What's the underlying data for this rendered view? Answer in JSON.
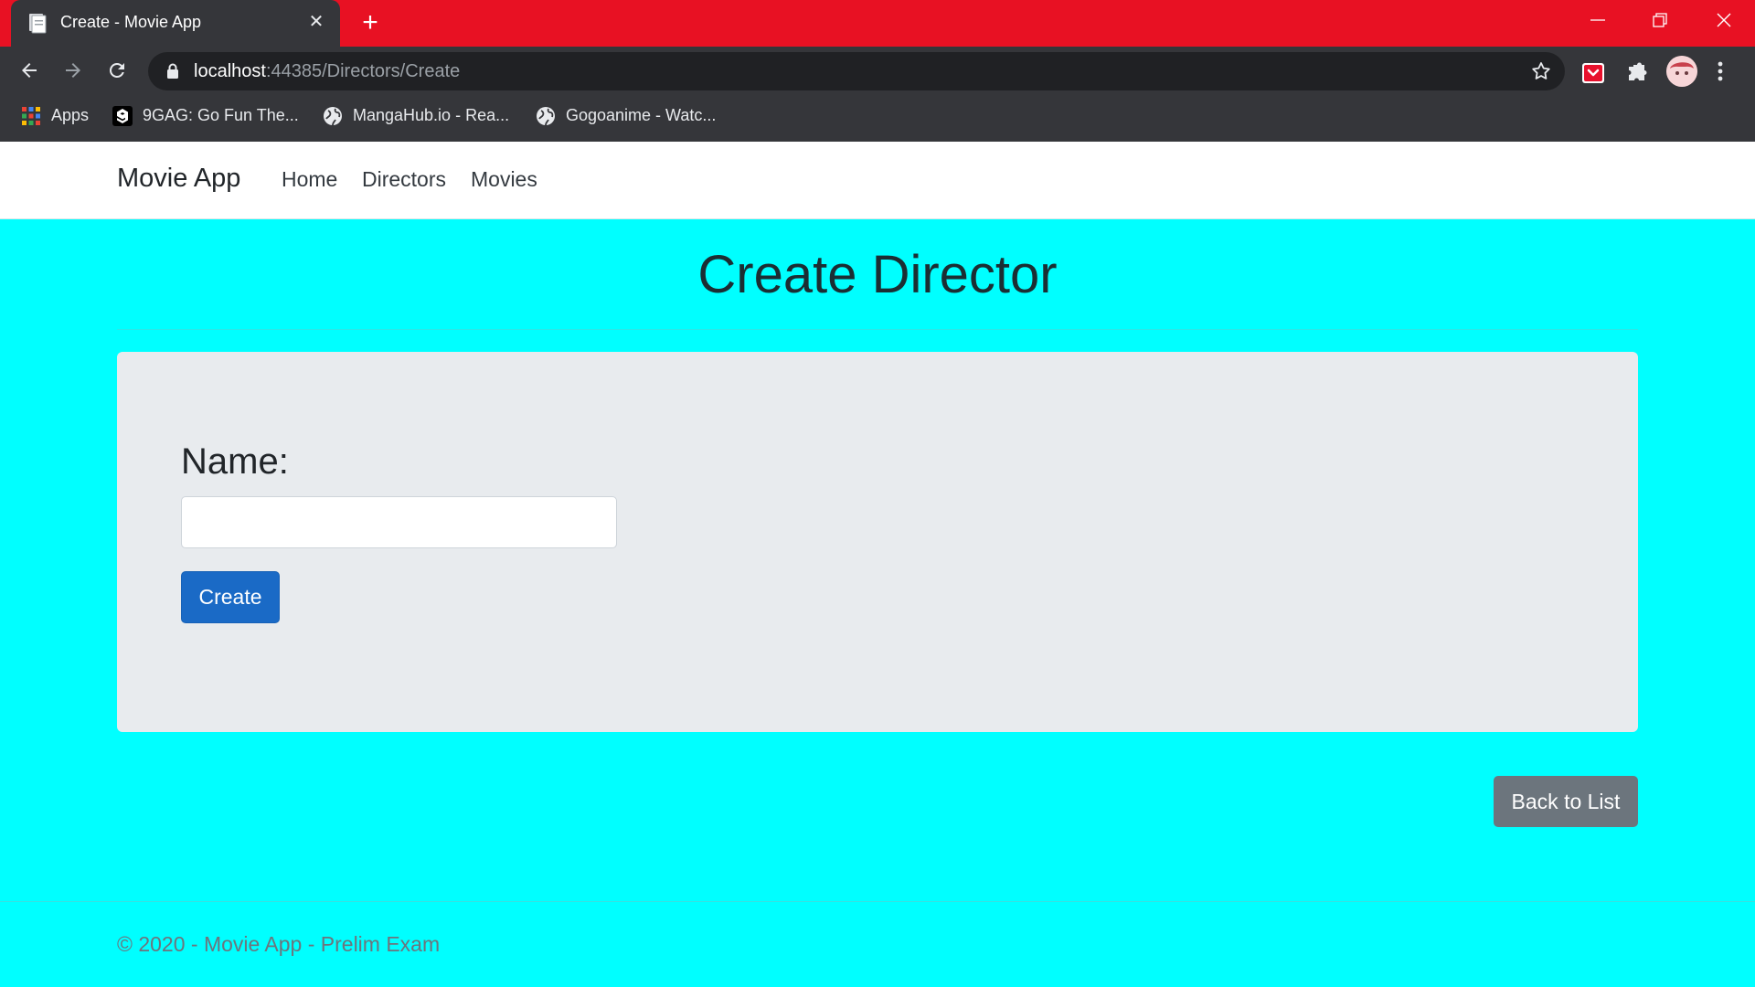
{
  "browser": {
    "tab_title": "Create - Movie App",
    "tab_close": "✕",
    "new_tab": "+",
    "url_host": "localhost",
    "url_rest": ":44385/Directors/Create",
    "bookmarks": [
      {
        "label": "Apps",
        "icon": "apps-grid-icon"
      },
      {
        "label": "9GAG: Go Fun The...",
        "icon": "9gag-icon"
      },
      {
        "label": "MangaHub.io - Rea...",
        "icon": "globe-icon"
      },
      {
        "label": "Gogoanime - Watc...",
        "icon": "globe-icon"
      }
    ],
    "colors": {
      "titlebar": "#e81123",
      "toolbar": "#35363a",
      "omnibox": "#202124"
    }
  },
  "navbar": {
    "brand": "Movie App",
    "links": [
      "Home",
      "Directors",
      "Movies"
    ]
  },
  "main": {
    "heading": "Create Director",
    "form": {
      "name_label": "Name:",
      "name_value": "",
      "name_placeholder": "",
      "submit_label": "Create"
    },
    "back_label": "Back to List"
  },
  "footer": {
    "text": "© 2020 - Movie App - Prelim Exam"
  },
  "colors": {
    "page_background": "#00ffff",
    "primary_button": "#1a6ac6",
    "secondary_button": "#6c757d"
  }
}
